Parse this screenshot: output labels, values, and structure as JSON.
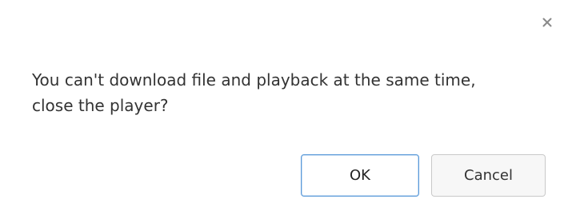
{
  "dialog": {
    "close_icon": "close-icon",
    "message": "You can't download file and playback at the same time, close the player?",
    "ok_label": "OK",
    "cancel_label": "Cancel"
  },
  "colors": {
    "ok_border": "#5b9ad9",
    "text": "#333333",
    "close_icon": "#8a8a8a"
  }
}
